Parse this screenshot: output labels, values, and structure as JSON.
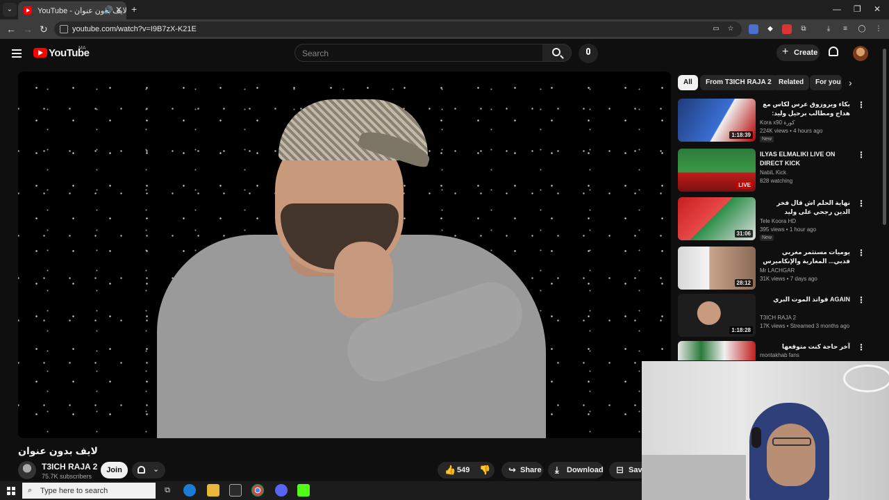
{
  "browser": {
    "tab_title": "YouTube - لايف بدون عنوان",
    "tab_audio_icon": "speaker-icon",
    "new_tab": "+",
    "url": "youtube.com/watch?v=I9B7zX-K21E"
  },
  "header": {
    "logo": "YouTube",
    "region": "MA",
    "search_placeholder": "Search",
    "create_label": "Create"
  },
  "video": {
    "title": "لايف بدون عنوان",
    "channel": "T3ICH RAJA 2",
    "subscribers": "75.7K subscribers",
    "join_label": "Join",
    "likes": "549",
    "share_label": "Share",
    "download_label": "Download",
    "save_label": "Save"
  },
  "chips": [
    "All",
    "From T3ICH RAJA 2",
    "Related",
    "For you"
  ],
  "recommendations": [
    {
      "title": "بكاء ويروزوق عرس لكاس مع هداج ومطالب برحيل وليد: تفتيح للشرب ماسمعون أقتتي ...",
      "channel": "Kora x90 كورة",
      "meta": "224K views • 4 hours ago",
      "badge": "New",
      "duration": "1:18:39",
      "rtl": true
    },
    {
      "title": "ILYAS ELMALIKI LIVE ON DIRECT KICK",
      "channel": "NabiL Kick",
      "meta": "828 watching",
      "badge": "",
      "duration": "LIVE",
      "rtl": false
    },
    {
      "title": "نهاية الحلم اش قال فخر الدين رجحي على وليد الركراكي",
      "channel": "Tele Koora HD",
      "meta": "395 views • 1 hour ago",
      "badge": "New",
      "duration": "31:06",
      "rtl": true
    },
    {
      "title": "يوميات مستثمر مغربي فدبي... المغاربة والإنكاميرس ف 2026؟",
      "channel": "Mr LACHGAR",
      "meta": "31K views • 7 days ago",
      "badge": "",
      "duration": "28:12",
      "rtl": true
    },
    {
      "title": "AGAIN فواتد الموت البري",
      "channel": "T3ICH RAJA 2",
      "meta": "17K views • Streamed 3 months ago",
      "badge": "",
      "duration": "1:18:28",
      "rtl": true
    },
    {
      "title": "آخر حاجة كنت متوقعها",
      "channel": "montakhab fans",
      "meta": "",
      "badge": "",
      "duration": "",
      "rtl": true
    }
  ],
  "taskbar": {
    "search_placeholder": "Type here to search"
  },
  "colors": {
    "background": "#0f0f0f",
    "accent": "#ff0000",
    "chip_active": "#f1f1f1"
  }
}
